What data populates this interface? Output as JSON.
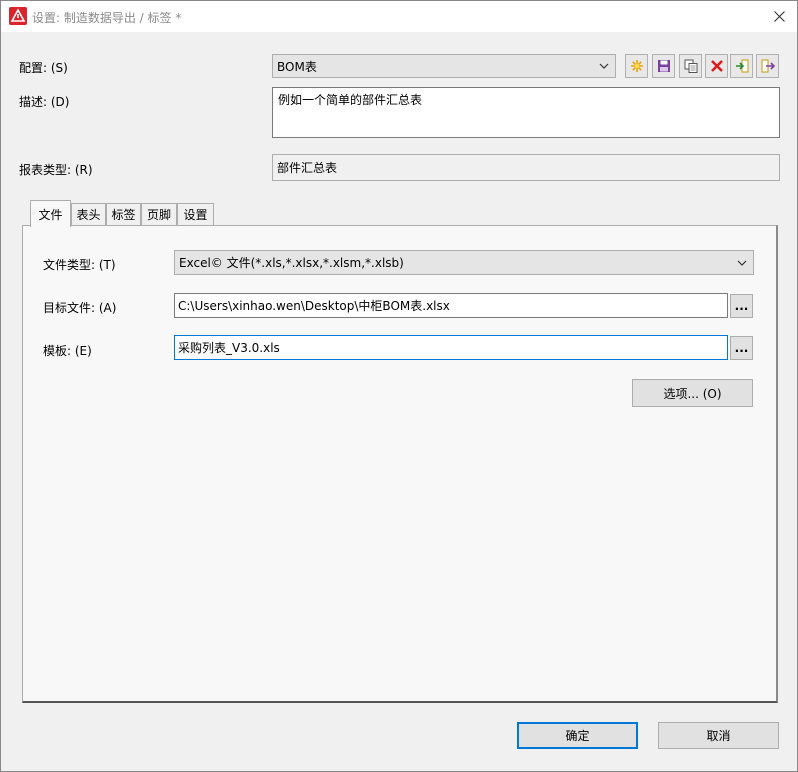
{
  "window": {
    "title": "设置: 制造数据导出 / 标签 *"
  },
  "config": {
    "label": "配置: (S)",
    "value": "BOM表"
  },
  "toolbar_icons": [
    "new-icon",
    "save-icon",
    "copy-icon",
    "delete-icon",
    "import-icon",
    "export-icon"
  ],
  "description": {
    "label": "描述: (D)",
    "value": "例如一个简单的部件汇总表"
  },
  "report_type": {
    "label": "报表类型: (R)",
    "value": "部件汇总表"
  },
  "tabs": [
    {
      "label": "文件",
      "active": true
    },
    {
      "label": "表头",
      "active": false
    },
    {
      "label": "标签",
      "active": false
    },
    {
      "label": "页脚",
      "active": false
    },
    {
      "label": "设置",
      "active": false
    }
  ],
  "file_tab": {
    "file_type": {
      "label": "文件类型: (T)",
      "value": "Excel© 文件(*.xls,*.xlsx,*.xlsm,*.xlsb)"
    },
    "target_file": {
      "label": "目标文件: (A)",
      "value": "C:\\Users\\xinhao.wen\\Desktop\\中柜BOM表.xlsx"
    },
    "template": {
      "label": "模板: (E)",
      "value": "采购列表_V3.0.xls"
    },
    "browse_label": "...",
    "options_button": "选项... (O)"
  },
  "buttons": {
    "ok": "确定",
    "cancel": "取消"
  },
  "colors": {
    "accent": "#0078d7",
    "app_icon_red": "#d9242b"
  }
}
